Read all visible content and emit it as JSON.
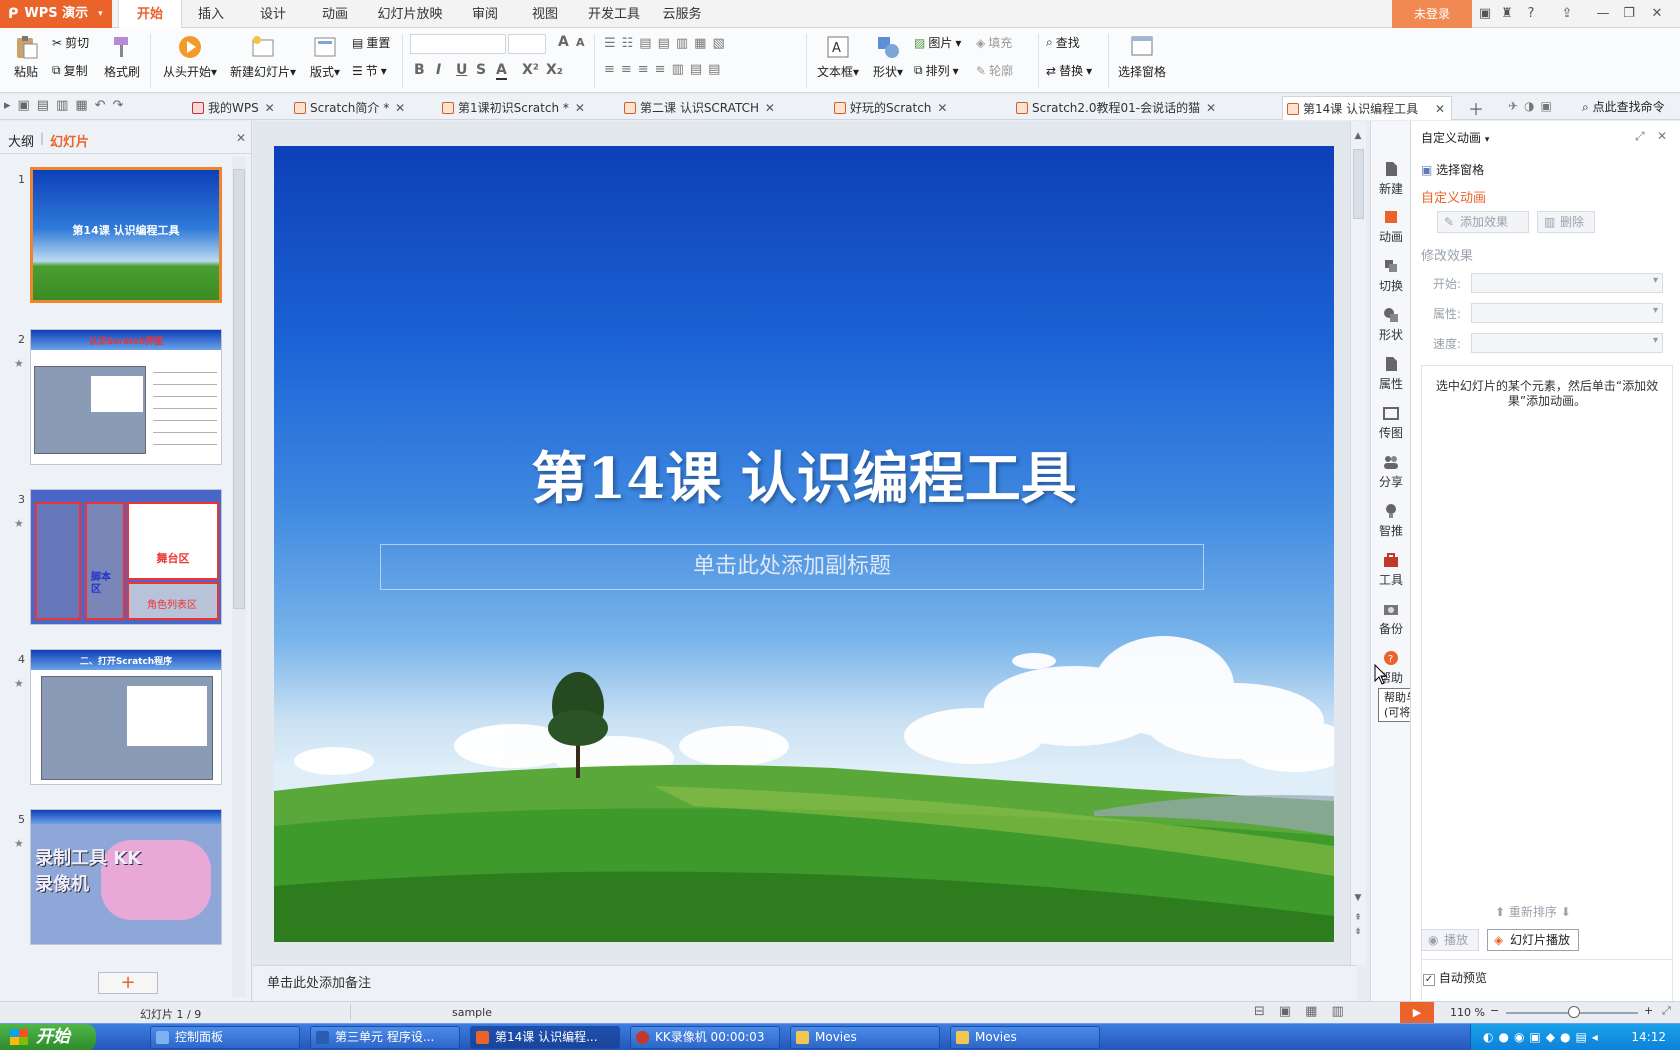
{
  "menubar": {
    "app_name": "WPS 演示",
    "tabs": [
      "开始",
      "插入",
      "设计",
      "动画",
      "幻灯片放映",
      "审阅",
      "视图",
      "开发工具",
      "云服务"
    ],
    "active_tab": "开始",
    "login": "未登录",
    "help": "?"
  },
  "ribbon": {
    "paste": "粘贴",
    "cut": "剪切",
    "copy": "复制",
    "format_painter": "格式刷",
    "from_start": "从头开始",
    "new_slide": "新建幻灯片",
    "layout": "版式",
    "reset": "重置",
    "section": "节",
    "textbox": "文本框",
    "shape": "形状",
    "picture": "图片",
    "fill": "填充",
    "arrange": "排列",
    "outline": "轮廓",
    "find": "查找",
    "replace": "替换",
    "select_pane": "选择窗格",
    "format_buttons": [
      "B",
      "I",
      "U",
      "S",
      "A",
      "X²",
      "X₂"
    ]
  },
  "doctabs": {
    "tabs": [
      {
        "label": "我的WPS"
      },
      {
        "label": "Scratch简介 *"
      },
      {
        "label": "第1课初识Scratch *"
      },
      {
        "label": "第二课 认识SCRATCH"
      },
      {
        "label": "好玩的Scratch"
      },
      {
        "label": "Scratch2.0教程01-会说话的猫"
      },
      {
        "label": "第14课 认识编程工具"
      }
    ],
    "search": "点此查找命令"
  },
  "leftpanel": {
    "tab_outline": "大纲",
    "tab_slides": "幻灯片",
    "thumbnails": [
      {
        "num": "1",
        "title": "第14课 认识编程工具"
      },
      {
        "num": "2",
        "title": "认识Scratch界面"
      },
      {
        "num": "3",
        "title": "舞台区",
        "labels": [
          "脚本区",
          "角色列表区"
        ]
      },
      {
        "num": "4",
        "title": "二、打开Scratch程序"
      },
      {
        "num": "5",
        "title": "录制工具 KK录像机"
      }
    ],
    "add": "+"
  },
  "slide": {
    "title": "第14课 认识编程工具",
    "subtitle_placeholder": "单击此处添加副标题"
  },
  "notes_placeholder": "单击此处添加备注",
  "iconstrip": {
    "items": [
      "新建",
      "动画",
      "切换",
      "形状",
      "属性",
      "传图",
      "分享",
      "智推",
      "工具",
      "备份",
      "帮助"
    ]
  },
  "tooltip": {
    "line1": "帮助与问答",
    "line2": "(可将本页拖至文档区)"
  },
  "taskpane": {
    "title": "自定义动画",
    "select_pane": "选择窗格",
    "section_title": "自定义动画",
    "add_effect": "添加效果",
    "delete": "删除",
    "modify_effect": "修改效果",
    "start_label": "开始:",
    "property_label": "属性:",
    "speed_label": "速度:",
    "hint": "选中幻灯片的某个元素，然后单击“添加效果”添加动画。",
    "reorder": "重新排序",
    "play": "播放",
    "slideshow": "幻灯片播放",
    "auto_preview": "自动预览",
    "auto_preview_checked": true
  },
  "statusbar": {
    "slide_info": "幻灯片 1 / 9",
    "template": "sample",
    "zoom": "110 %"
  },
  "taskbar": {
    "start": "开始",
    "tasks": [
      {
        "label": "控制面板",
        "icon_color": "#7fb0f0"
      },
      {
        "label": "第三单元  程序设...",
        "icon_color": "#2a5db0"
      },
      {
        "label": "第14课 认识编程...",
        "icon_color": "#e9632a"
      },
      {
        "label": "KK录像机  00:00:03",
        "icon_color": "#c0392b"
      },
      {
        "label": "Movies",
        "icon_color": "#f3c74f"
      },
      {
        "label": "Movies",
        "icon_color": "#f3c74f"
      }
    ],
    "clock": "14:12"
  },
  "colors": {
    "accent": "#e9632a",
    "slide_sky": "#1c63d6",
    "grass": "#3f9a2c"
  }
}
